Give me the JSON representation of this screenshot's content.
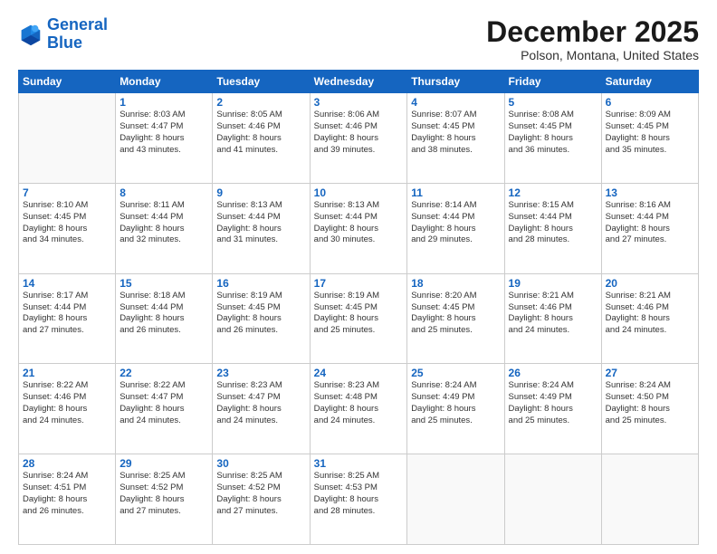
{
  "header": {
    "logo_line1": "General",
    "logo_line2": "Blue",
    "month": "December 2025",
    "location": "Polson, Montana, United States"
  },
  "weekdays": [
    "Sunday",
    "Monday",
    "Tuesday",
    "Wednesday",
    "Thursday",
    "Friday",
    "Saturday"
  ],
  "weeks": [
    [
      {
        "num": "",
        "info": ""
      },
      {
        "num": "1",
        "info": "Sunrise: 8:03 AM\nSunset: 4:47 PM\nDaylight: 8 hours\nand 43 minutes."
      },
      {
        "num": "2",
        "info": "Sunrise: 8:05 AM\nSunset: 4:46 PM\nDaylight: 8 hours\nand 41 minutes."
      },
      {
        "num": "3",
        "info": "Sunrise: 8:06 AM\nSunset: 4:46 PM\nDaylight: 8 hours\nand 39 minutes."
      },
      {
        "num": "4",
        "info": "Sunrise: 8:07 AM\nSunset: 4:45 PM\nDaylight: 8 hours\nand 38 minutes."
      },
      {
        "num": "5",
        "info": "Sunrise: 8:08 AM\nSunset: 4:45 PM\nDaylight: 8 hours\nand 36 minutes."
      },
      {
        "num": "6",
        "info": "Sunrise: 8:09 AM\nSunset: 4:45 PM\nDaylight: 8 hours\nand 35 minutes."
      }
    ],
    [
      {
        "num": "7",
        "info": "Sunrise: 8:10 AM\nSunset: 4:45 PM\nDaylight: 8 hours\nand 34 minutes."
      },
      {
        "num": "8",
        "info": "Sunrise: 8:11 AM\nSunset: 4:44 PM\nDaylight: 8 hours\nand 32 minutes."
      },
      {
        "num": "9",
        "info": "Sunrise: 8:13 AM\nSunset: 4:44 PM\nDaylight: 8 hours\nand 31 minutes."
      },
      {
        "num": "10",
        "info": "Sunrise: 8:13 AM\nSunset: 4:44 PM\nDaylight: 8 hours\nand 30 minutes."
      },
      {
        "num": "11",
        "info": "Sunrise: 8:14 AM\nSunset: 4:44 PM\nDaylight: 8 hours\nand 29 minutes."
      },
      {
        "num": "12",
        "info": "Sunrise: 8:15 AM\nSunset: 4:44 PM\nDaylight: 8 hours\nand 28 minutes."
      },
      {
        "num": "13",
        "info": "Sunrise: 8:16 AM\nSunset: 4:44 PM\nDaylight: 8 hours\nand 27 minutes."
      }
    ],
    [
      {
        "num": "14",
        "info": "Sunrise: 8:17 AM\nSunset: 4:44 PM\nDaylight: 8 hours\nand 27 minutes."
      },
      {
        "num": "15",
        "info": "Sunrise: 8:18 AM\nSunset: 4:44 PM\nDaylight: 8 hours\nand 26 minutes."
      },
      {
        "num": "16",
        "info": "Sunrise: 8:19 AM\nSunset: 4:45 PM\nDaylight: 8 hours\nand 26 minutes."
      },
      {
        "num": "17",
        "info": "Sunrise: 8:19 AM\nSunset: 4:45 PM\nDaylight: 8 hours\nand 25 minutes."
      },
      {
        "num": "18",
        "info": "Sunrise: 8:20 AM\nSunset: 4:45 PM\nDaylight: 8 hours\nand 25 minutes."
      },
      {
        "num": "19",
        "info": "Sunrise: 8:21 AM\nSunset: 4:46 PM\nDaylight: 8 hours\nand 24 minutes."
      },
      {
        "num": "20",
        "info": "Sunrise: 8:21 AM\nSunset: 4:46 PM\nDaylight: 8 hours\nand 24 minutes."
      }
    ],
    [
      {
        "num": "21",
        "info": "Sunrise: 8:22 AM\nSunset: 4:46 PM\nDaylight: 8 hours\nand 24 minutes."
      },
      {
        "num": "22",
        "info": "Sunrise: 8:22 AM\nSunset: 4:47 PM\nDaylight: 8 hours\nand 24 minutes."
      },
      {
        "num": "23",
        "info": "Sunrise: 8:23 AM\nSunset: 4:47 PM\nDaylight: 8 hours\nand 24 minutes."
      },
      {
        "num": "24",
        "info": "Sunrise: 8:23 AM\nSunset: 4:48 PM\nDaylight: 8 hours\nand 24 minutes."
      },
      {
        "num": "25",
        "info": "Sunrise: 8:24 AM\nSunset: 4:49 PM\nDaylight: 8 hours\nand 25 minutes."
      },
      {
        "num": "26",
        "info": "Sunrise: 8:24 AM\nSunset: 4:49 PM\nDaylight: 8 hours\nand 25 minutes."
      },
      {
        "num": "27",
        "info": "Sunrise: 8:24 AM\nSunset: 4:50 PM\nDaylight: 8 hours\nand 25 minutes."
      }
    ],
    [
      {
        "num": "28",
        "info": "Sunrise: 8:24 AM\nSunset: 4:51 PM\nDaylight: 8 hours\nand 26 minutes."
      },
      {
        "num": "29",
        "info": "Sunrise: 8:25 AM\nSunset: 4:52 PM\nDaylight: 8 hours\nand 27 minutes."
      },
      {
        "num": "30",
        "info": "Sunrise: 8:25 AM\nSunset: 4:52 PM\nDaylight: 8 hours\nand 27 minutes."
      },
      {
        "num": "31",
        "info": "Sunrise: 8:25 AM\nSunset: 4:53 PM\nDaylight: 8 hours\nand 28 minutes."
      },
      {
        "num": "",
        "info": ""
      },
      {
        "num": "",
        "info": ""
      },
      {
        "num": "",
        "info": ""
      }
    ]
  ]
}
